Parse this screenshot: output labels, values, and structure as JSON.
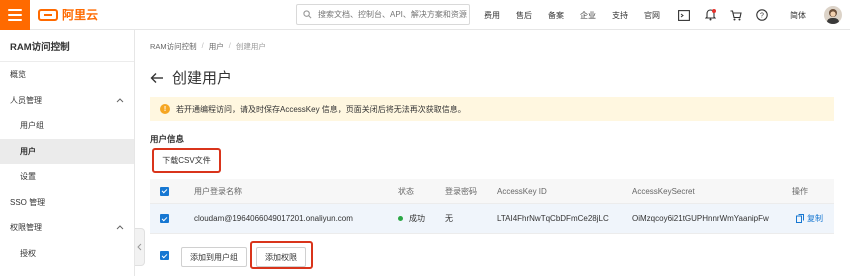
{
  "topbar": {
    "logo_text": "阿里云",
    "search_placeholder": "搜索文档、控制台、API、解决方案和资源",
    "nav": [
      "费用",
      "售后",
      "备案",
      "企业",
      "支持",
      "官网"
    ],
    "lang": "简体"
  },
  "sidebar": {
    "title": "RAM访问控制",
    "items": [
      {
        "label": "概览"
      },
      {
        "label": "人员管理"
      },
      {
        "label": "用户组"
      },
      {
        "label": "用户"
      },
      {
        "label": "设置"
      },
      {
        "label": "SSO 管理"
      },
      {
        "label": "权限管理"
      },
      {
        "label": "授权"
      }
    ]
  },
  "breadcrumb": {
    "items": [
      "RAM访问控制",
      "用户",
      "创建用户"
    ],
    "separator": "/"
  },
  "page": {
    "title": "创建用户"
  },
  "alert": {
    "text": "若开通编程访问，请及时保存AccessKey 信息，页面关闭后将无法再次获取信息。"
  },
  "user_info": {
    "section_title": "用户信息",
    "download_csv": "下载CSV文件"
  },
  "table": {
    "headers": [
      "用户登录名称",
      "状态",
      "登录密码",
      "AccessKey ID",
      "AccessKeySecret",
      "操作"
    ],
    "rows": [
      {
        "login_name": "cloudam@1964066049017201.onaliyun.com",
        "status": "成功",
        "password": "无",
        "access_key_id": "LTAI4FhrNwTqCbDFmCe28jLC",
        "access_key_secret": "OiMzqcoy6i21tGUPHnnrWmYaanipFw",
        "action": "复制"
      }
    ]
  },
  "footer": {
    "add_to_group": "添加到用户组",
    "add_permission": "添加权限"
  },
  "colors": {
    "brand": "#ff6a00",
    "link": "#1677d2",
    "success": "#2ba745",
    "highlight": "#d9341b",
    "alert_bg": "#fff7e0"
  }
}
